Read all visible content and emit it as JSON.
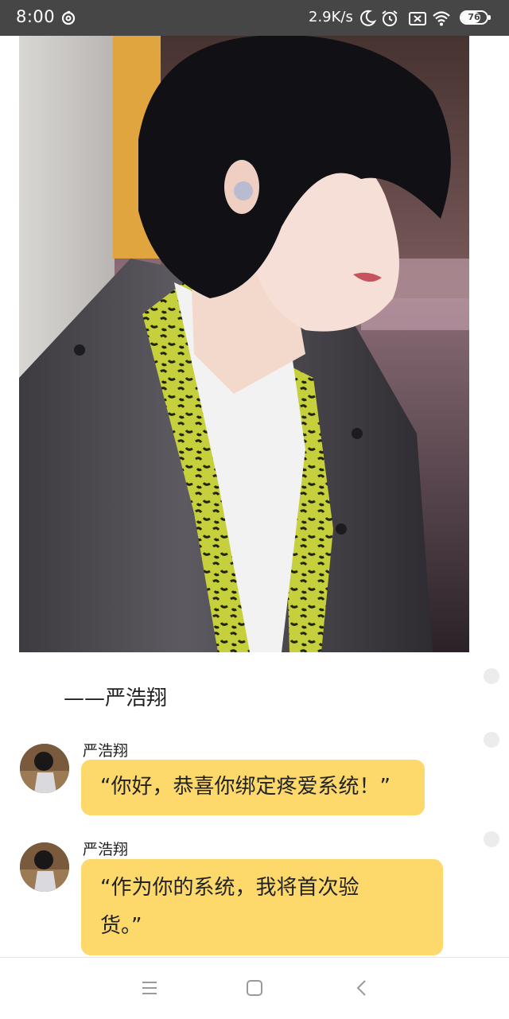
{
  "status_bar": {
    "time": "8:00",
    "net_speed": "2.9K/s",
    "battery_level": "76",
    "battery_fraction": 0.76,
    "icons": [
      "netease-music-icon",
      "moon-icon",
      "alarm-icon",
      "no-sim-icon",
      "wifi-icon",
      "battery-icon"
    ]
  },
  "content": {
    "caption": "——严浩翔",
    "messages": [
      {
        "sender": "严浩翔",
        "text": "“你好，恭喜你绑定疼爱系统！”"
      },
      {
        "sender": "严浩翔",
        "text_line1": "“作为你的系统，我将首次验",
        "text_line2": "货。”"
      }
    ]
  },
  "nav_bar": {
    "buttons": [
      "menu-icon",
      "home-icon",
      "back-icon"
    ]
  },
  "colors": {
    "status_bar_bg": "#464646",
    "bubble_bg": "#fdd96b",
    "page_bg": "#ffffff"
  }
}
